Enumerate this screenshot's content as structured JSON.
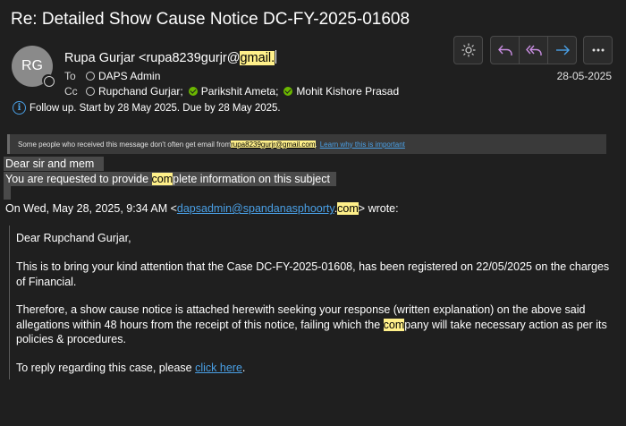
{
  "email": {
    "subject": "Re: Detailed Show Cause Notice DC-FY-2025-01608",
    "avatar_initials": "RG",
    "sender_name_prefix": "Rupa Gurjar <rupa8239gurjr@",
    "sender_highlight": "gmail.",
    "to_label": "To",
    "to": [
      {
        "name": "DAPS Admin",
        "status": "unknown"
      }
    ],
    "cc_label": "Cc",
    "cc": [
      {
        "name": "Rupchand Gurjar;",
        "status": "unknown"
      },
      {
        "name": "Parikshit Ameta;",
        "status": "verified"
      },
      {
        "name": "Mohit Kishore Prasad",
        "status": "verified"
      }
    ],
    "followup_text": "Follow up.  Start by 28 May 2025.  Due by 28 May 2025.",
    "date": "28-05-2025"
  },
  "toolbar": {
    "icons": [
      "sun-icon",
      "reply-icon",
      "reply-all-icon",
      "forward-icon",
      "more-icon"
    ]
  },
  "banner": {
    "text_before": "Some people who received this message don't often get email from ",
    "email": "rupa8239gurjr@gmail.com",
    "text_after": ".",
    "link": "Learn why this is important"
  },
  "body": {
    "greeting": "Dear sir and mem",
    "request_pre": "You are requested to provide ",
    "request_hl": "com",
    "request_post": "plete information on this subject",
    "wrote_pre": "On Wed, May 28, 2025, 9:34 AM <",
    "wrote_link": "dapsadmin@spandanasphoorty",
    "wrote_dot": ".",
    "wrote_hl": "com",
    "wrote_post": "> wrote:"
  },
  "quoted": {
    "salutation": "Dear Rupchand Gurjar,",
    "para1": "This is to bring your kind attention that the Case DC-FY-2025-01608, has been registered on 22/05/2025 on the charges of Financial.",
    "para2_pre": "Therefore, a show cause notice is attached herewith seeking your response (written explanation) on the above said allegations within 48 hours from the receipt of this notice, failing which the ",
    "para2_hl": "com",
    "para2_post": "pany will take necessary action as per its policies & procedures.",
    "para3_pre": "To reply regarding this case, please ",
    "para3_link": "click here",
    "para3_post": "."
  },
  "colors": {
    "background": "#1f1f1f",
    "highlight": "#fff08a",
    "link": "#4aa0e6",
    "verified": "#6bb700",
    "accent_icon": "#c88de0"
  }
}
